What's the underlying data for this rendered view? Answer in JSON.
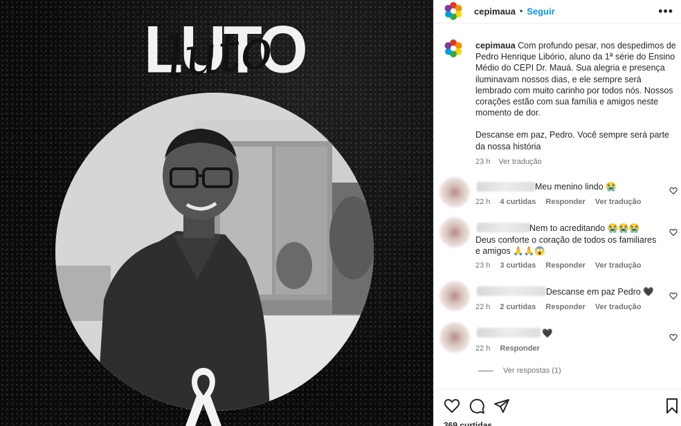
{
  "post": {
    "username": "cepimaua",
    "dot": "•",
    "follow_label": "Seguir",
    "more_label": "•••"
  },
  "image": {
    "title_block": "LUTO",
    "title_script": "luto"
  },
  "caption": {
    "username": "cepimaua",
    "text": " Com profundo pesar, nos despedimos de Pedro Henrique Libório, aluno da 1ª série do Ensino Médio do CEPI Dr. Mauá. Sua alegria e presença iluminavam nossos dias, e ele sempre será lembrado com muito carinho por todos nós. Nossos corações estão com sua família e amigos neste momento de dor.",
    "text2": "Descanse em paz, Pedro. Você sempre será parte da nossa história",
    "time": "23 h",
    "translate": "Ver tradução"
  },
  "comments": [
    {
      "text": " Meu menino lindo 😭",
      "time": "22 h",
      "likes": "4 curtidas",
      "reply": "Responder",
      "translate": "Ver tradução"
    },
    {
      "text": " Nem to acreditando 😭😭😭",
      "text2": "Deus conforte o coração de todos os familiares e amigos 🙏🙏😱",
      "time": "23 h",
      "likes": "3 curtidas",
      "reply": "Responder",
      "translate": "Ver tradução"
    },
    {
      "text": " Descanse em paz Pedro 🖤",
      "time": "22 h",
      "likes": "2 curtidas",
      "reply": "Responder",
      "translate": "Ver tradução"
    },
    {
      "text": "🖤",
      "time": "22 h",
      "reply": "Responder"
    }
  ],
  "view_replies": "Ver respostas (1)",
  "likes_peek": "369 curtidas",
  "icons": {
    "like": "heart-icon",
    "comment": "comment-icon",
    "share": "paper-plane-icon",
    "save": "bookmark-icon"
  },
  "colors": {
    "follow": "#0095f6",
    "muted": "#737373",
    "text": "#262626"
  }
}
